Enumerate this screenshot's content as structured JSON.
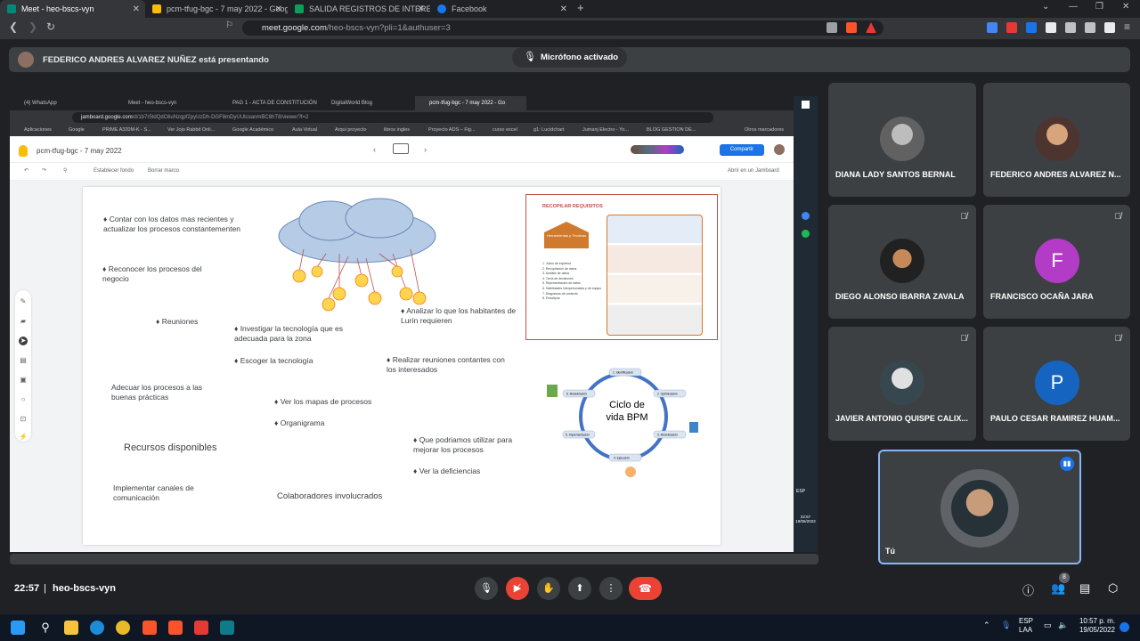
{
  "browser": {
    "tabs": [
      {
        "label": "Meet - heo-bscs-vyn",
        "active": true,
        "color": "#00897b"
      },
      {
        "label": "pcm-tfug-bgc - 7 may 2022 - Google",
        "active": false,
        "color": "#fbbc04"
      },
      {
        "label": "SALIDA REGISTROS DE INTERESADOS",
        "active": false,
        "color": "#0f9d58"
      },
      {
        "label": "Facebook",
        "active": false,
        "color": "#1877f2"
      }
    ],
    "url_host": "meet.google.com",
    "url_path": "/heo-bscs-vyn?pli=1&authuser=3"
  },
  "presentation": {
    "presenter_text": "FEDERICO ANDRES ALVAREZ NUÑEZ está presentando",
    "mic_status": "Micrófono activado"
  },
  "shared": {
    "inner_tabs": [
      "(4) WhatsApp",
      "Meet - heo-bscs-vyn",
      "PAG 1 - ACTA DE CONSTITUCIÓN",
      "DigitalWorld Blog",
      "pcm-tfug-bgc - 7 may 2022 - Go"
    ],
    "inner_url_host": "jamboard.google.com",
    "inner_url_path": "/d/1b7r5tdQdC6uNzqpf2pyUzDh-DGF8mDyUUlcoanmBC8hT8/viewer?f=2",
    "bookmarks": [
      "Aplicaciones",
      "Google",
      "PRIME A320M-K - S...",
      "Ver Jojo Rabbit Onli...",
      "Google Académico",
      "Aula Virtual",
      "Arqui proyecto",
      "libros ingles",
      "Proyecto ADS – Fig...",
      "curso excel",
      "g1: Lucidchart",
      "Jumanj Electro - Yo...",
      "BLOG GESTION DE...",
      "Otros marcadores"
    ],
    "jam_title": "pcm-tfug-bgc - 7 may 2022",
    "share_label": "Compartir",
    "set_background": "Establecer fondo",
    "clear_frame": "Borrar marco",
    "open_in_jamboard": "Abrir en un Jamboard",
    "notes": [
      "♦ Contar con los datos mas recientes y actualizar los procesos constantementen",
      "♦ Reconocer los procesos del negocio",
      "♦ Reuniones",
      "♦ Investigar la tecnología que es adecuada para la zona",
      "♦ Analizar lo que los habitantes de Lurín requieren",
      "♦ Escoger la tecnología",
      "♦ Realizar reuniones contantes con los interesados",
      "Adecuar los procesos a las buenas prácticas",
      "♦ Ver los mapas de procesos",
      "♦ Organigrama",
      "Recursos disponibles",
      "♦ Que podriamos utilizar para mejorar los procesos",
      "♦ Ver la deficiencias",
      "Implementar canales de comunicación",
      "Colaboradores involucrados"
    ],
    "requirements": {
      "title": "RECOPILAR REQUISITOS",
      "tools_label": "Herramientas y Técnicas",
      "list": [
        "1. Juicio de expertos",
        "2. Recopilación de datos",
        "3. Análisis de datos",
        "4. Toma de decisiones",
        "5. Representación de datos",
        "6. Habilidades interpersonales y de equipo",
        "7. Diagramas de contexto",
        "8. Prototipos"
      ]
    },
    "bpm": {
      "center": "Ciclo de vida BPM",
      "stages": [
        "1. Identificación",
        "2. Optimización",
        "3. Modelización",
        "4. Ejecución",
        "5. Implementación",
        "6. Modelización"
      ]
    }
  },
  "participants": [
    {
      "name": "DIANA LADY SANTOS BERNAL",
      "muted": false,
      "type": "photo",
      "color": "#9e9e9e"
    },
    {
      "name": "FEDERICO ANDRES ALVAREZ N...",
      "muted": false,
      "type": "photo",
      "color": "#8d6e63"
    },
    {
      "name": "DIEGO ALONSO IBARRA ZAVALA",
      "muted": true,
      "type": "photo",
      "color": "#6d4c41"
    },
    {
      "name": "FRANCISCO OCAÑA JARA",
      "muted": true,
      "type": "letter",
      "letter": "F",
      "color": "#b23cc6"
    },
    {
      "name": "JAVIER ANTONIO QUISPE CALIX...",
      "muted": true,
      "type": "photo",
      "color": "#546e7a"
    },
    {
      "name": "PAULO CESAR RAMIREZ HUAM...",
      "muted": true,
      "type": "letter",
      "letter": "P",
      "color": "#1565c0"
    }
  ],
  "self_tile": {
    "name": "Tú"
  },
  "meeting": {
    "time": "22:57",
    "code": "heo-bscs-vyn",
    "people_count": "8"
  },
  "taskbar": {
    "lang1": "ESP",
    "lang2": "LAA",
    "time": "10:57 p. m.",
    "date": "19/05/2022",
    "inner_time": "22:57",
    "inner_date": "19/05/2022",
    "inner_lang": "ESP"
  }
}
